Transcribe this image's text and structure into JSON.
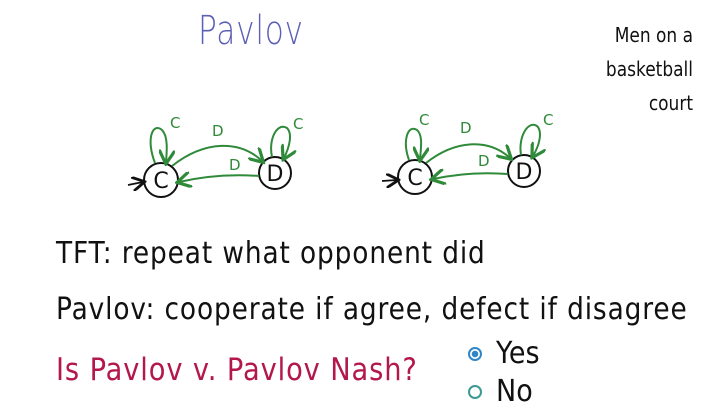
{
  "title": "Pavlov",
  "side_note": [
    "Men on a",
    "basketball",
    "court"
  ],
  "diagram": {
    "state_c": "C",
    "state_d": "D",
    "edge_c": "C",
    "edge_d": "D"
  },
  "lines": {
    "tft": "TFT:  repeat what opponent did",
    "pavlov": "Pavlov:  cooperate if agree, defect if disagree"
  },
  "question": "Is Pavlov v. Pavlov Nash?",
  "options": [
    {
      "label": "Yes",
      "selected": true
    },
    {
      "label": "No",
      "selected": false
    }
  ],
  "colors": {
    "title": "#5b5fb5",
    "arrows": "#2f8a3a",
    "question": "#b3174b",
    "radio_selected": "#2f86c9"
  }
}
